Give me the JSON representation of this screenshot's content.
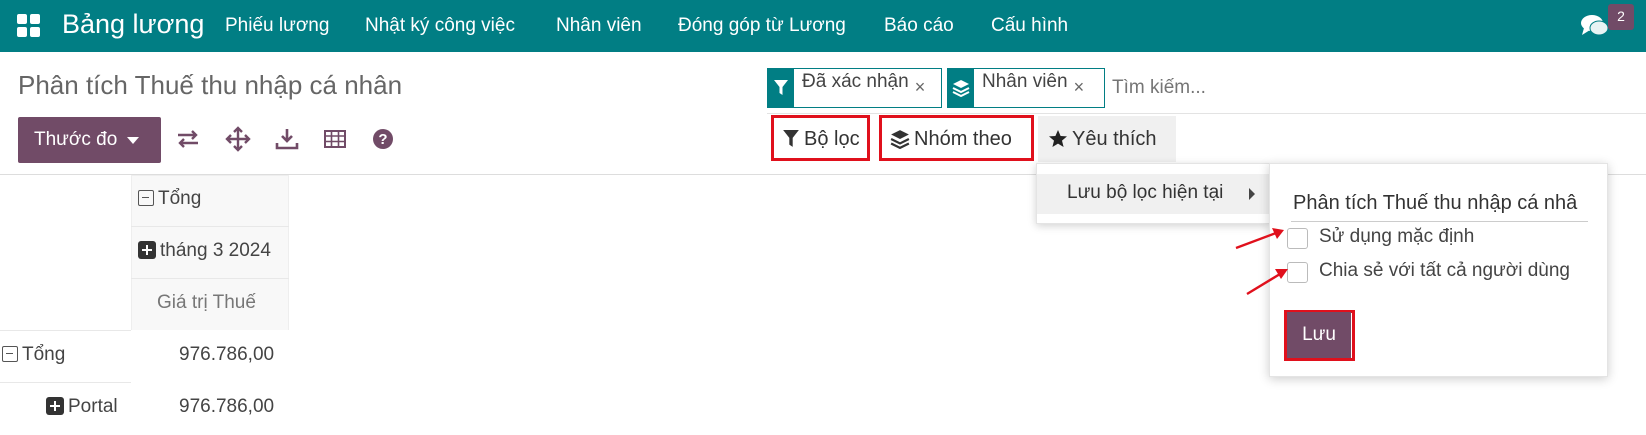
{
  "navbar": {
    "app_name": "Bảng lương",
    "menu": [
      "Phiếu lương",
      "Nhật ký công việc",
      "Nhân viên",
      "Đóng góp từ Lương",
      "Báo cáo",
      "Cấu hình"
    ],
    "badge_count": "2"
  },
  "control_panel": {
    "title": "Phân tích Thuế thu nhập cá nhân",
    "facets": [
      {
        "icon": "filter-icon",
        "value": "Đã xác nhận",
        "remove": "×"
      },
      {
        "icon": "layers-icon",
        "value": "Nhân viên",
        "remove": "×"
      }
    ],
    "search_placeholder": "Tìm kiếm...",
    "measures_label": "Thước đo",
    "filter_label": "Bộ lọc",
    "groupby_label": "Nhóm theo",
    "favorites_label": "Yêu thích"
  },
  "pivot": {
    "col_total": "Tổng",
    "col_group": "tháng 3 2024",
    "measure": "Giá trị Thuế",
    "rows": [
      {
        "label": "Tổng",
        "value": "976.786,00"
      },
      {
        "label": "Portal",
        "value": "976.786,00"
      }
    ]
  },
  "favorites_menu": {
    "save_current": "Lưu bộ lọc hiện tại",
    "filter_name": "Phân tích Thuế thu nhập cá nhâ",
    "use_default": "Sử dụng mặc định",
    "share_all": "Chia sẻ với tất cả người dùng",
    "save_button": "Lưu"
  },
  "colors": {
    "primary": "#714b67",
    "navbar": "#017e84",
    "highlight": "#e0101c"
  }
}
